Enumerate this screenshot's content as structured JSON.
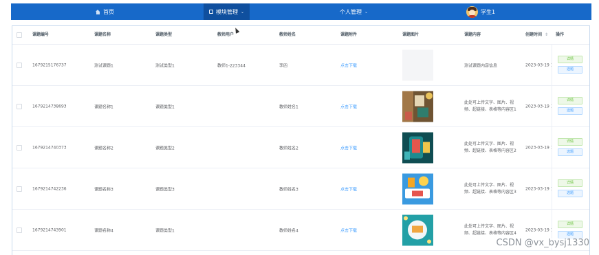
{
  "nav": {
    "home": "首页",
    "module": "模块管理",
    "personal": "个人管理",
    "user": "学生1"
  },
  "table": {
    "columns": {
      "code": "课题编号",
      "name": "课题名称",
      "type": "课题类型",
      "teacher_account": "教师用户",
      "teacher_name": "教师姓名",
      "attachment": "课题附件",
      "image": "课题图片",
      "content": "课题内容",
      "created": "创建时间",
      "sort": "⇕",
      "actions": "操作"
    },
    "rows": [
      {
        "code": "1679215176737",
        "name": "测试课题1",
        "type": "测试类型1",
        "teacher_account": "教师1-223344",
        "teacher_name": "李四",
        "attachment": "点击下载",
        "image": "",
        "content": "测试课题内容信息",
        "created": "2023-03-19 1"
      },
      {
        "code": "1679214738693",
        "name": "课题名称1",
        "type": "课题类型1",
        "teacher_account": "",
        "teacher_name": "教师姓名1",
        "attachment": "点击下载",
        "image": "classroom-photo",
        "content": "此处可上传文字、图片、视频、超链接、表格等内容区1",
        "created": "2023-03-19 1"
      },
      {
        "code": "1679214740373",
        "name": "课题名称2",
        "type": "课题类型2",
        "teacher_account": "",
        "teacher_name": "教师姓名2",
        "attachment": "点击下载",
        "image": "online-learning-illustration",
        "content": "此处可上传文字、图片、视频、超链接、表格等内容区2",
        "created": "2023-03-19 1"
      },
      {
        "code": "1679214742236",
        "name": "课题名称3",
        "type": "课题类型3",
        "teacher_account": "",
        "teacher_name": "教师姓名3",
        "attachment": "点击下载",
        "image": "graduation-illustration",
        "content": "此处可上传文字、图片、视频、超链接、表格等内容区3",
        "created": "2023-03-19 1"
      },
      {
        "code": "1679214743901",
        "name": "课题名称4",
        "type": "课题类型1",
        "teacher_account": "",
        "teacher_name": "教师姓名4",
        "attachment": "点击下载",
        "image": "open-book-illustration",
        "content": "此处可上传文字、图片、视频、超链接、表格等内容区4",
        "created": "2023-03-19 1"
      }
    ],
    "buttons": {
      "detail": "详情",
      "select": "选题"
    }
  },
  "watermark": "CSDN @vx_bysj1330",
  "colors": {
    "nav_bg": "#1769c9",
    "nav_active": "#0f4f9e",
    "link": "#409eff",
    "detail_green": "#67c23a"
  }
}
